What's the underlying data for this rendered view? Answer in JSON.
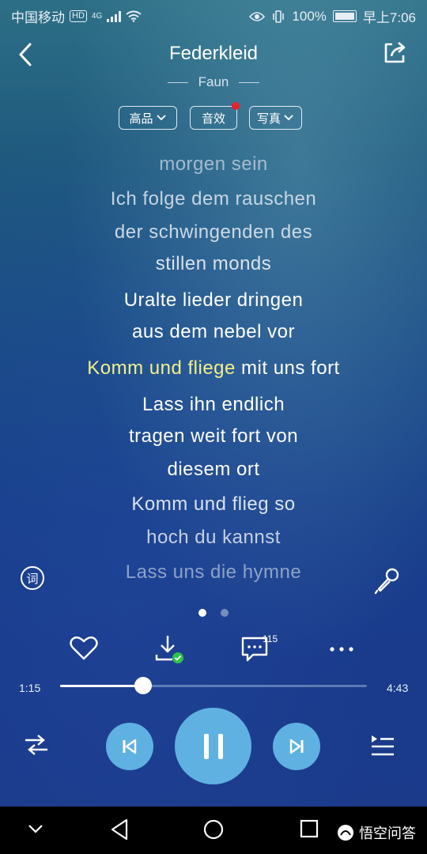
{
  "status_bar": {
    "carrier": "中国移动",
    "hd": "HD",
    "network": "4G",
    "battery": "100%",
    "time": "早上7:06"
  },
  "header": {
    "title": "Federkleid",
    "artist": "Faun"
  },
  "options": [
    {
      "label": "高品",
      "dropdown": true
    },
    {
      "label": "音效",
      "dropdown": false,
      "badge": true
    },
    {
      "label": "写真",
      "dropdown": true
    }
  ],
  "lyrics": [
    {
      "text": "morgen sein",
      "state": "past"
    },
    {
      "text": "Ich folge dem rauschen",
      "state": "normal"
    },
    {
      "text": "der schwingenden des",
      "state": "normal"
    },
    {
      "text": "stillen monds",
      "state": "normal"
    },
    {
      "text": "Uralte lieder dringen",
      "state": "normal"
    },
    {
      "text": "aus dem nebel vor",
      "state": "normal"
    },
    {
      "text_sung": "Komm und fliege",
      "text_rest": " mit uns fort",
      "state": "current"
    },
    {
      "text": "Lass ihn endlich",
      "state": "normal"
    },
    {
      "text": "tragen weit fort von",
      "state": "normal"
    },
    {
      "text": "diesem ort",
      "state": "normal"
    },
    {
      "text": "Komm und flieg so",
      "state": "normal"
    },
    {
      "text": "hoch du kannst",
      "state": "normal"
    },
    {
      "text": "Lass uns die hymne",
      "state": "fading"
    }
  ],
  "lyric_tools": {
    "ci_label": "词"
  },
  "pager": {
    "pages": 2,
    "active": 0
  },
  "actions": {
    "comment_count": "115"
  },
  "player": {
    "elapsed": "1:15",
    "total": "4:43",
    "progress": 0.27
  },
  "watermark": "悟空问答",
  "colors": {
    "highlight": "#f2f08a",
    "accent": "#5fb1e2",
    "badge": "#e8222a",
    "download_ok": "#2fc24a"
  }
}
